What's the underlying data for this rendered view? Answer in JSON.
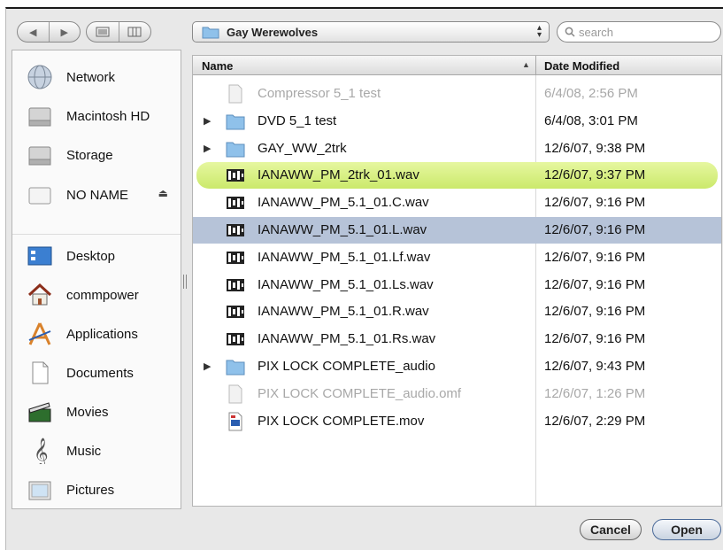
{
  "toolbar": {
    "back_icon": "back-arrow-icon",
    "forward_icon": "forward-arrow-icon",
    "list_view_icon": "list-view-icon",
    "column_view_icon": "column-view-icon",
    "location": "Gay Werewolves",
    "search_placeholder": "search"
  },
  "sidebar": {
    "devices": [
      {
        "label": "Network",
        "icon": "network-globe-icon"
      },
      {
        "label": "Macintosh HD",
        "icon": "hard-drive-icon"
      },
      {
        "label": "Storage",
        "icon": "hard-drive-icon"
      },
      {
        "label": "NO NAME",
        "icon": "removable-drive-icon",
        "eject": "⏏"
      }
    ],
    "places": [
      {
        "label": "Desktop",
        "icon": "desktop-icon"
      },
      {
        "label": "commpower",
        "icon": "home-icon"
      },
      {
        "label": "Applications",
        "icon": "applications-icon"
      },
      {
        "label": "Documents",
        "icon": "documents-icon"
      },
      {
        "label": "Movies",
        "icon": "movies-icon"
      },
      {
        "label": "Music",
        "icon": "music-icon"
      },
      {
        "label": "Pictures",
        "icon": "pictures-icon"
      }
    ]
  },
  "file_list": {
    "columns": {
      "name": "Name",
      "date": "Date Modified"
    },
    "rows": [
      {
        "name": "Compressor 5_1 test",
        "date": "6/4/08, 2:56 PM",
        "kind": "document",
        "state": "dimmed",
        "expandable": false
      },
      {
        "name": "DVD 5_1 test",
        "date": "6/4/08, 3:01 PM",
        "kind": "folder",
        "state": "normal",
        "expandable": true
      },
      {
        "name": "GAY_WW_2trk",
        "date": "12/6/07, 9:38 PM",
        "kind": "folder",
        "state": "normal",
        "expandable": true
      },
      {
        "name": "IANAWW_PM_2trk_01.wav",
        "date": "12/6/07, 9:37 PM",
        "kind": "audio",
        "state": "labeled-green",
        "expandable": false
      },
      {
        "name": "IANAWW_PM_5.1_01.C.wav",
        "date": "12/6/07, 9:16 PM",
        "kind": "audio",
        "state": "normal",
        "expandable": false
      },
      {
        "name": "IANAWW_PM_5.1_01.L.wav",
        "date": "12/6/07, 9:16 PM",
        "kind": "audio",
        "state": "selected",
        "expandable": false
      },
      {
        "name": "IANAWW_PM_5.1_01.Lf.wav",
        "date": "12/6/07, 9:16 PM",
        "kind": "audio",
        "state": "normal",
        "expandable": false
      },
      {
        "name": "IANAWW_PM_5.1_01.Ls.wav",
        "date": "12/6/07, 9:16 PM",
        "kind": "audio",
        "state": "normal",
        "expandable": false
      },
      {
        "name": "IANAWW_PM_5.1_01.R.wav",
        "date": "12/6/07, 9:16 PM",
        "kind": "audio",
        "state": "normal",
        "expandable": false
      },
      {
        "name": "IANAWW_PM_5.1_01.Rs.wav",
        "date": "12/6/07, 9:16 PM",
        "kind": "audio",
        "state": "normal",
        "expandable": false
      },
      {
        "name": "PIX LOCK COMPLETE_audio",
        "date": "12/6/07, 9:43 PM",
        "kind": "folder",
        "state": "normal",
        "expandable": true
      },
      {
        "name": "PIX LOCK COMPLETE_audio.omf",
        "date": "12/6/07, 1:26 PM",
        "kind": "document",
        "state": "dimmed",
        "expandable": false
      },
      {
        "name": "PIX LOCK COMPLETE.mov",
        "date": "12/6/07, 2:29 PM",
        "kind": "movie",
        "state": "normal",
        "expandable": false
      }
    ]
  },
  "buttons": {
    "cancel": "Cancel",
    "open": "Open"
  },
  "colors": {
    "selection": "#b6c3d8",
    "green_label": "#cbe96b",
    "folder": "#8fc1ea"
  }
}
